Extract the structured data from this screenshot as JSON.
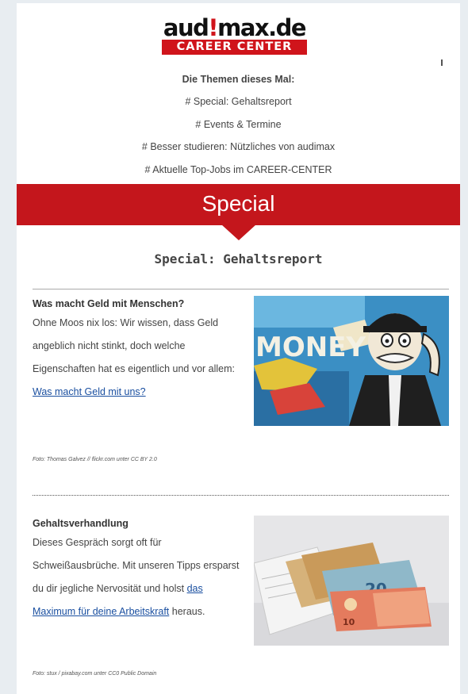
{
  "logo": {
    "top_pre": "aud",
    "top_bang": "!",
    "top_post": "max.de",
    "bottom": "CAREER CENTER"
  },
  "topics": {
    "heading": "Die Themen dieses Mal:",
    "items": [
      "# Special: Gehaltsreport",
      "# Events & Termine",
      "# Besser studieren: Nützliches von audimax",
      "# Aktuelle Top-Jobs im CAREER-CENTER"
    ]
  },
  "banner": {
    "label": "Special"
  },
  "section": {
    "title": "Special: Gehaltsreport"
  },
  "articles": [
    {
      "title": "Was macht Geld mit Menschen?",
      "body_text": "Ohne Moos nix los: Wir wissen, dass Geld angeblich nicht stinkt, doch welche Eigenschaften hat es eigentlich und vor allem: ",
      "link": "Was macht Geld mit uns?",
      "body_after": "",
      "credit": "Foto: Thomas Galvez // flickr.com unter CC BY 2.0",
      "image_text": "MONEY",
      "image_icon": "monopoly-money-graffiti-image"
    },
    {
      "title": "Gehaltsverhandlung",
      "body_text": "Dieses Gespräch sorgt oft für Schweißausbrüche. Mit unseren Tipps ersparst du dir jegliche Nervosität und holst ",
      "link": "das Maximum für deine Arbeitskraft",
      "body_after": " heraus.",
      "credit": "Foto: stux / pixabay.com unter CC0 Public Domain",
      "image_text": "20",
      "image_icon": "euro-banknotes-image"
    }
  ],
  "colors": {
    "brand_red": "#c4161c",
    "link": "#1a4fa0",
    "page_bg": "#e8edf1"
  }
}
